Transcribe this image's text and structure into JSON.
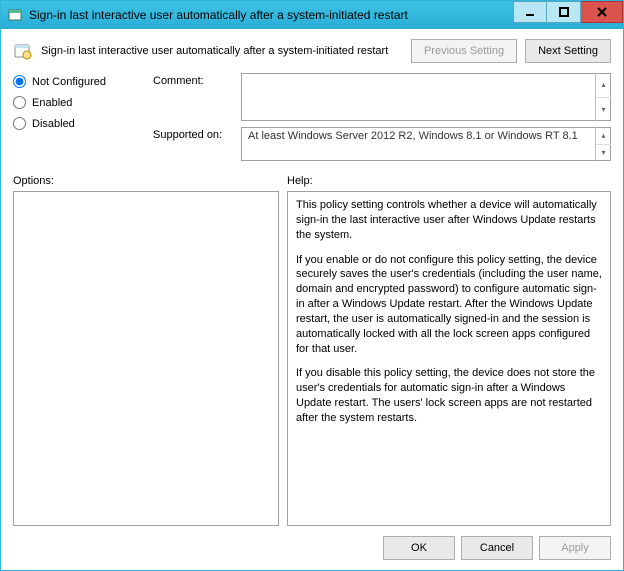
{
  "window": {
    "title": "Sign-in last interactive user automatically after a system-initiated restart"
  },
  "header": {
    "policy_title": "Sign-in last interactive user automatically after a system-initiated restart",
    "previous_setting": "Previous Setting",
    "next_setting": "Next Setting"
  },
  "state": {
    "not_configured": "Not Configured",
    "enabled": "Enabled",
    "disabled": "Disabled",
    "selected": "not_configured"
  },
  "fields": {
    "comment_label": "Comment:",
    "comment_value": "",
    "supported_label": "Supported on:",
    "supported_value": "At least Windows Server 2012 R2, Windows 8.1 or Windows RT 8.1"
  },
  "panes": {
    "options_label": "Options:",
    "help_label": "Help:",
    "options_content": "",
    "help_paragraphs": [
      "This policy setting controls whether a device will automatically sign-in the last interactive user after Windows Update restarts the system.",
      "If you enable or do not configure this policy setting, the device securely saves the user's credentials (including the user name, domain and encrypted password) to configure automatic sign-in after a Windows Update restart. After the Windows Update restart, the user is automatically signed-in and the session is automatically locked with all the lock screen apps configured for that user.",
      "If you disable this policy setting, the device does not store the user's credentials for automatic sign-in after a Windows Update restart. The users' lock screen apps are not restarted after the system restarts."
    ]
  },
  "footer": {
    "ok": "OK",
    "cancel": "Cancel",
    "apply": "Apply"
  }
}
